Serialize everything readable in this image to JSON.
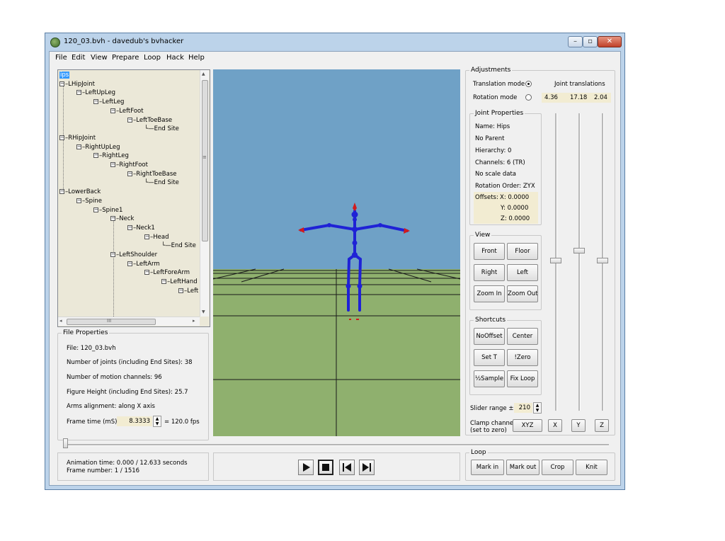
{
  "window": {
    "title": "120_03.bvh - davedub's bvhacker",
    "close_glyph": "✕",
    "maximize_glyph": "▫",
    "minimize_glyph": "–"
  },
  "menu": [
    "File",
    "Edit",
    "View",
    "Prepare",
    "Loop",
    "Hack",
    "Help"
  ],
  "tree": {
    "selected": "ips",
    "nodes": [
      {
        "label": "ips",
        "depth": 0
      },
      {
        "label": "LHipJoint",
        "depth": 0
      },
      {
        "label": "LeftUpLeg",
        "depth": 1
      },
      {
        "label": "LeftLeg",
        "depth": 2
      },
      {
        "label": "LeftFoot",
        "depth": 3
      },
      {
        "label": "LeftToeBase",
        "depth": 4
      },
      {
        "label": "End Site",
        "depth": 5
      },
      {
        "label": "RHipJoint",
        "depth": 0
      },
      {
        "label": "RightUpLeg",
        "depth": 1
      },
      {
        "label": "RightLeg",
        "depth": 2
      },
      {
        "label": "RightFoot",
        "depth": 3
      },
      {
        "label": "RightToeBase",
        "depth": 4
      },
      {
        "label": "End Site",
        "depth": 5
      },
      {
        "label": "LowerBack",
        "depth": 0
      },
      {
        "label": "Spine",
        "depth": 1
      },
      {
        "label": "Spine1",
        "depth": 2
      },
      {
        "label": "Neck",
        "depth": 3
      },
      {
        "label": "Neck1",
        "depth": 4
      },
      {
        "label": "Head",
        "depth": 5
      },
      {
        "label": "End Site",
        "depth": 6
      },
      {
        "label": "LeftShoulder",
        "depth": 3
      },
      {
        "label": "LeftArm",
        "depth": 4
      },
      {
        "label": "LeftForeArm",
        "depth": 5
      },
      {
        "label": "LeftHand",
        "depth": 6
      },
      {
        "label": "Left",
        "depth": 7
      }
    ],
    "hscroll_grip": "III",
    "vscroll_grip": "≡"
  },
  "file_properties": {
    "title": "File Properties",
    "file": "File: 120_03.bvh",
    "joints": "Number of joints (including End Sites): 38",
    "channels": "Number of motion channels: 96",
    "height": "Figure Height (including End Sites): 25.7",
    "arms": "Arms alignment: along X axis",
    "frame_time_label": "Frame time (mS)",
    "frame_time_value": "8.3333",
    "fps": "= 120.0 fps"
  },
  "status": {
    "animation_time": "Animation time: 0.000 / 12.633 seconds",
    "frame_number": "Frame number: 1 / 1516"
  },
  "adjustments": {
    "title": "Adjustments",
    "translation_mode": "Translation mode",
    "rotation_mode": "Rotation mode",
    "joint_translations": "Joint translations",
    "tx": "4.36",
    "ty": "17.18",
    "tz": "2.04",
    "selected_mode": "translation"
  },
  "joint_properties": {
    "title": "Joint Properties",
    "name": "Name: Hips",
    "parent": "No Parent",
    "hierarchy": "Hierarchy: 0",
    "channels": "Channels: 6 (TR)",
    "scale": "No scale data",
    "rotation_order": "Rotation Order: ZYX",
    "offsets_label": "Offsets:",
    "offset_x": "X:  0.0000",
    "offset_y": "Y:  0.0000",
    "offset_z": "Z:  0.0000"
  },
  "view": {
    "title": "View",
    "front": "Front",
    "floor": "Floor",
    "right": "Right",
    "left": "Left",
    "zoom_in": "Zoom In",
    "zoom_out": "Zoom Out"
  },
  "shortcuts": {
    "title": "Shortcuts",
    "nooffset": "NoOffset",
    "center": "Center",
    "set_t": "Set T",
    "zero": "!Zero",
    "half_sample": "½Sample",
    "fix_loop": "Fix Loop"
  },
  "slider_range": {
    "label": "Slider range ±",
    "value": "210"
  },
  "clamp": {
    "label_line1": "Clamp channel",
    "label_line2": "(set to zero)",
    "xyz": "XYZ",
    "x": "X",
    "y": "Y",
    "z": "Z"
  },
  "loop": {
    "title": "Loop",
    "mark_in": "Mark in",
    "mark_out": "Mark out",
    "crop": "Crop",
    "knit": "Knit"
  },
  "colors": {
    "sky": "#6fa1c6",
    "ground": "#8fb06e",
    "skeleton": "#1f22d6",
    "end_effector": "#d11c1c",
    "tree_bg": "#ebe8d8",
    "field_bg": "#f2ecd2",
    "selection": "#3399ff"
  },
  "icons": {
    "play": "play-icon",
    "stop": "stop-icon",
    "prev": "skip-back-icon",
    "next": "skip-forward-icon"
  }
}
